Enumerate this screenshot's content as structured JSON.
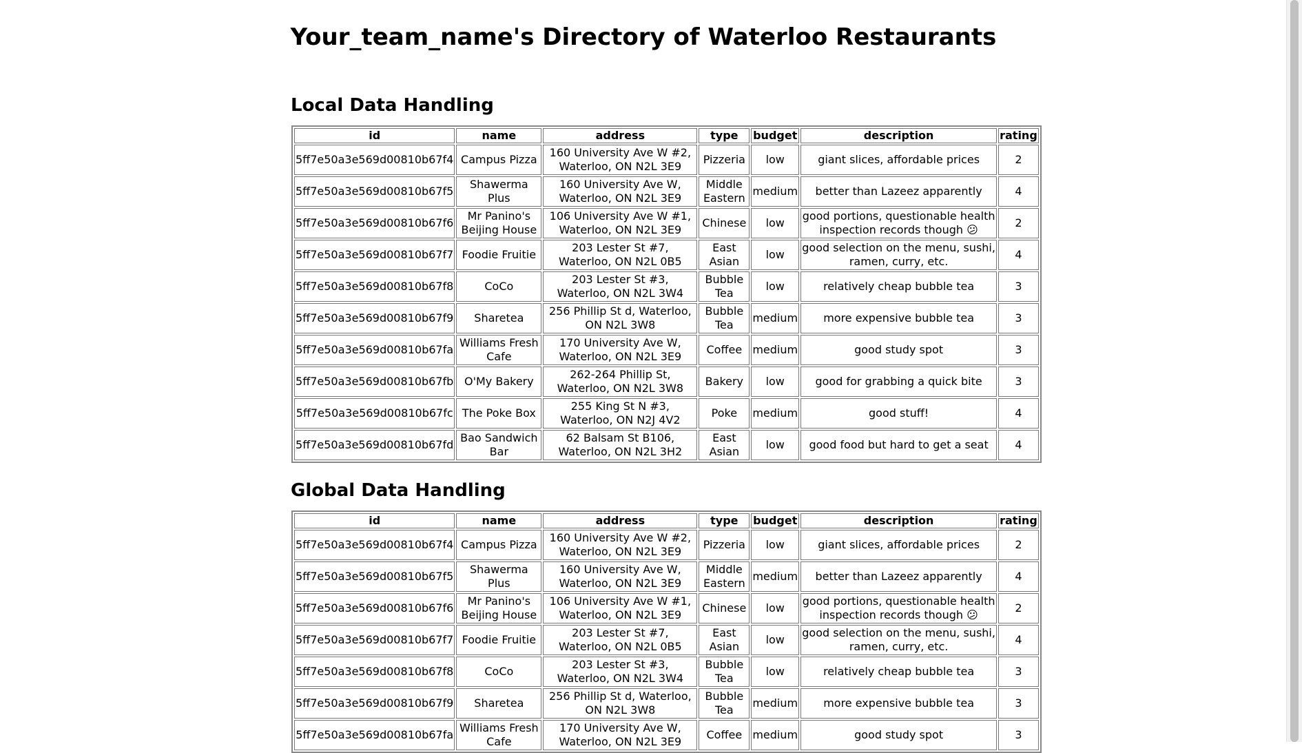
{
  "page": {
    "title": "Your_team_name's Directory of Waterloo Restaurants"
  },
  "columns": [
    "id",
    "name",
    "address",
    "type",
    "budget",
    "description",
    "rating"
  ],
  "sections": [
    {
      "heading": "Local Data Handling",
      "rows": [
        [
          "5ff7e50a3e569d00810b67f4",
          "Campus Pizza",
          "160 University Ave W #2, Waterloo, ON N2L 3E9",
          "Pizzeria",
          "low",
          "giant slices, affordable prices",
          "2"
        ],
        [
          "5ff7e50a3e569d00810b67f5",
          "Shawerma Plus",
          "160 University Ave W, Waterloo, ON N2L 3E9",
          "Middle Eastern",
          "medium",
          "better than Lazeez apparently",
          "4"
        ],
        [
          "5ff7e50a3e569d00810b67f6",
          "Mr Panino's Beijing House",
          "106 University Ave W #1, Waterloo, ON N2L 3E9",
          "Chinese",
          "low",
          "good portions, questionable health inspection records though 😕",
          "2"
        ],
        [
          "5ff7e50a3e569d00810b67f7",
          "Foodie Fruitie",
          "203 Lester St #7, Waterloo, ON N2L 0B5",
          "East Asian",
          "low",
          "good selection on the menu, sushi, ramen, curry, etc.",
          "4"
        ],
        [
          "5ff7e50a3e569d00810b67f8",
          "CoCo",
          "203 Lester St #3, Waterloo, ON N2L 3W4",
          "Bubble Tea",
          "low",
          "relatively cheap bubble tea",
          "3"
        ],
        [
          "5ff7e50a3e569d00810b67f9",
          "Sharetea",
          "256 Phillip St d, Waterloo, ON N2L 3W8",
          "Bubble Tea",
          "medium",
          "more expensive bubble tea",
          "3"
        ],
        [
          "5ff7e50a3e569d00810b67fa",
          "Williams Fresh Cafe",
          "170 University Ave W, Waterloo, ON N2L 3E9",
          "Coffee",
          "medium",
          "good study spot",
          "3"
        ],
        [
          "5ff7e50a3e569d00810b67fb",
          "O'My Bakery",
          "262-264 Phillip St, Waterloo, ON N2L 3W8",
          "Bakery",
          "low",
          "good for grabbing a quick bite",
          "3"
        ],
        [
          "5ff7e50a3e569d00810b67fc",
          "The Poke Box",
          "255 King St N #3, Waterloo, ON N2J 4V2",
          "Poke",
          "medium",
          "good stuff!",
          "4"
        ],
        [
          "5ff7e50a3e569d00810b67fd",
          "Bao Sandwich Bar",
          "62 Balsam St B106, Waterloo, ON N2L 3H2",
          "East Asian",
          "low",
          "good food but hard to get a seat",
          "4"
        ]
      ]
    },
    {
      "heading": "Global Data Handling",
      "rows": [
        [
          "5ff7e50a3e569d00810b67f4",
          "Campus Pizza",
          "160 University Ave W #2, Waterloo, ON N2L 3E9",
          "Pizzeria",
          "low",
          "giant slices, affordable prices",
          "2"
        ],
        [
          "5ff7e50a3e569d00810b67f5",
          "Shawerma Plus",
          "160 University Ave W, Waterloo, ON N2L 3E9",
          "Middle Eastern",
          "medium",
          "better than Lazeez apparently",
          "4"
        ],
        [
          "5ff7e50a3e569d00810b67f6",
          "Mr Panino's Beijing House",
          "106 University Ave W #1, Waterloo, ON N2L 3E9",
          "Chinese",
          "low",
          "good portions, questionable health inspection records though 😕",
          "2"
        ],
        [
          "5ff7e50a3e569d00810b67f7",
          "Foodie Fruitie",
          "203 Lester St #7, Waterloo, ON N2L 0B5",
          "East Asian",
          "low",
          "good selection on the menu, sushi, ramen, curry, etc.",
          "4"
        ],
        [
          "5ff7e50a3e569d00810b67f8",
          "CoCo",
          "203 Lester St #3, Waterloo, ON N2L 3W4",
          "Bubble Tea",
          "low",
          "relatively cheap bubble tea",
          "3"
        ],
        [
          "5ff7e50a3e569d00810b67f9",
          "Sharetea",
          "256 Phillip St d, Waterloo, ON N2L 3W8",
          "Bubble Tea",
          "medium",
          "more expensive bubble tea",
          "3"
        ],
        [
          "5ff7e50a3e569d00810b67fa",
          "Williams Fresh Cafe",
          "170 University Ave W, Waterloo, ON N2L 3E9",
          "Coffee",
          "medium",
          "good study spot",
          "3"
        ]
      ]
    }
  ]
}
